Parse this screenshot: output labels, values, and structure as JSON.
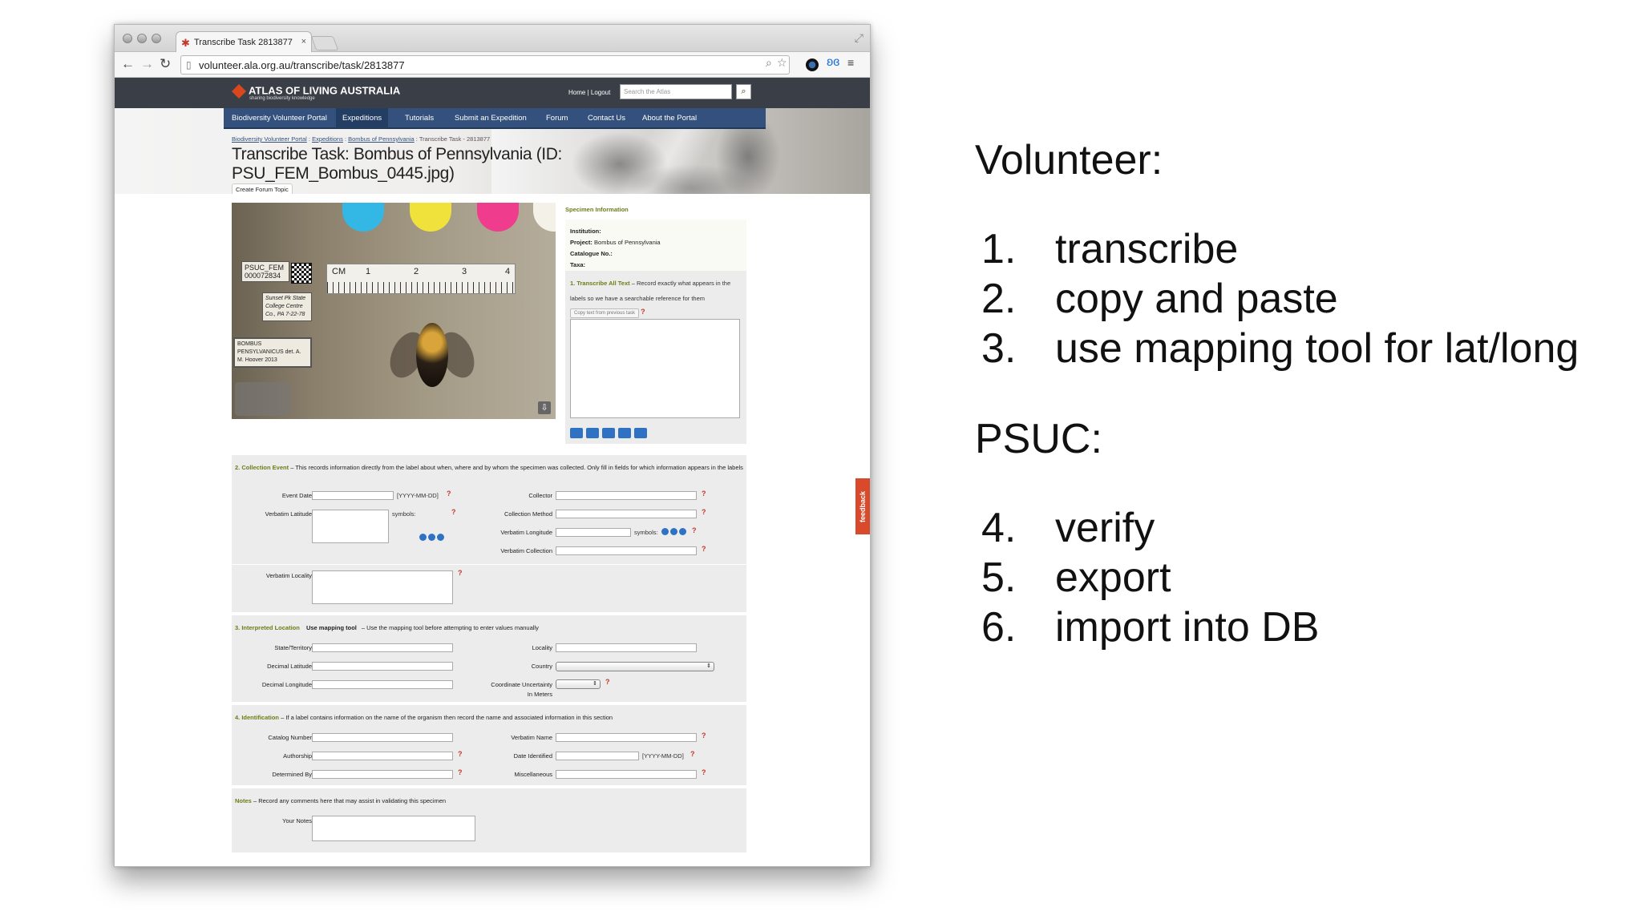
{
  "browser": {
    "tab_title": "Transcribe Task 2813877",
    "tab_close": "×",
    "url": "volunteer.ala.org.au/transcribe/task/2813877",
    "back_icon": "arrow-left-icon",
    "forward_icon": "arrow-right-icon",
    "reload_icon": "reload-icon"
  },
  "site": {
    "logo_text": "ATLAS OF LIVING AUSTRALIA",
    "logo_sub": "sharing biodiversity knowledge",
    "header_links": "Home | Logout",
    "search_placeholder": "Search the Atlas",
    "nav": [
      "Biodiversity Volunteer Portal",
      "Expeditions",
      "Tutorials",
      "Submit an Expedition",
      "Forum",
      "Contact Us",
      "About the Portal"
    ],
    "breadcrumb": [
      "Biodiversity Volunteer Portal",
      "Expeditions",
      "Bombus of Pennsylvania",
      "Transcribe Task - 2813877"
    ],
    "page_title": "Transcribe Task: Bombus of Pennsylvania (ID: PSU_FEM_Bombus_0445.jpg)",
    "forum_button": "Create Forum Topic",
    "feedback": "feedback"
  },
  "specimen_image": {
    "label1": "PSUC_FEM 000072834",
    "label2": "Sunset Pk State College Centre Co., PA 7-22-78",
    "label3": "BOMBUS PENSYLVANICUS det. A. M. Hoover 2013",
    "ruler_unit": "CM",
    "ruler_numbers": [
      "1",
      "2",
      "3",
      "4"
    ]
  },
  "specimen_info": {
    "heading": "Specimen Information",
    "institution_label": "Institution:",
    "project_label": "Project:",
    "project_value": "Bombus of Pennsylvania",
    "catalogue_label": "Catalogue No.:",
    "taxa_label": "Taxa:"
  },
  "transcribe_all": {
    "heading": "1. Transcribe All Text",
    "text": "– Record exactly what appears in the labels so we have a searchable reference for them",
    "copy_button": "Copy text from previous task"
  },
  "collection_event": {
    "heading": "2. Collection Event",
    "text": "– This records information directly from the label about when, where and by whom the specimen was collected. Only fill in fields for which information appears in the labels",
    "event_date": "Event Date",
    "date_hint": "[YYYY-MM-DD]",
    "verbatim_latitude": "Verbatim Latitude",
    "symbols": "symbols:",
    "verbatim_locality": "Verbatim Locality",
    "collector": "Collector",
    "collection_method": "Collection Method",
    "verbatim_longitude": "Verbatim Longitude",
    "verbatim_collection": "Verbatim Collection"
  },
  "interpreted_location": {
    "heading": "3. Interpreted Location",
    "mapping_button": "Use mapping tool",
    "text": "– Use the mapping tool before attempting to enter values manually",
    "state": "State/Territory",
    "dec_lat": "Decimal Latitude",
    "dec_long": "Decimal Longitude",
    "locality": "Locality",
    "country": "Country",
    "coord_uncert": "Coordinate Uncertainty",
    "in_meters": "In Meters"
  },
  "identification": {
    "heading": "4. Identification",
    "text": "– If a label contains information on the name of the organism then record the name and associated information in this section",
    "catalog_number": "Catalog Number",
    "authorship": "Authorship",
    "determined_by": "Determined By",
    "verbatim_name": "Verbatim Name",
    "date_identified": "Date Identified",
    "date_hint": "[YYYY-MM-DD]",
    "miscellaneous": "Miscellaneous"
  },
  "notes": {
    "heading": "Notes",
    "text": "– Record any comments here that may assist in validating this specimen",
    "your_notes": "Your Notes"
  },
  "slide": {
    "volunteer_heading": "Volunteer:",
    "volunteer_items": [
      {
        "num": "1.",
        "text": "transcribe"
      },
      {
        "num": "2.",
        "text": "copy and paste"
      },
      {
        "num": "3.",
        "text": "use mapping tool for lat/long"
      }
    ],
    "psuc_heading": "PSUC:",
    "psuc_items": [
      {
        "num": "4.",
        "text": "verify"
      },
      {
        "num": "5.",
        "text": "export"
      },
      {
        "num": "6.",
        "text": "import into DB"
      }
    ]
  }
}
